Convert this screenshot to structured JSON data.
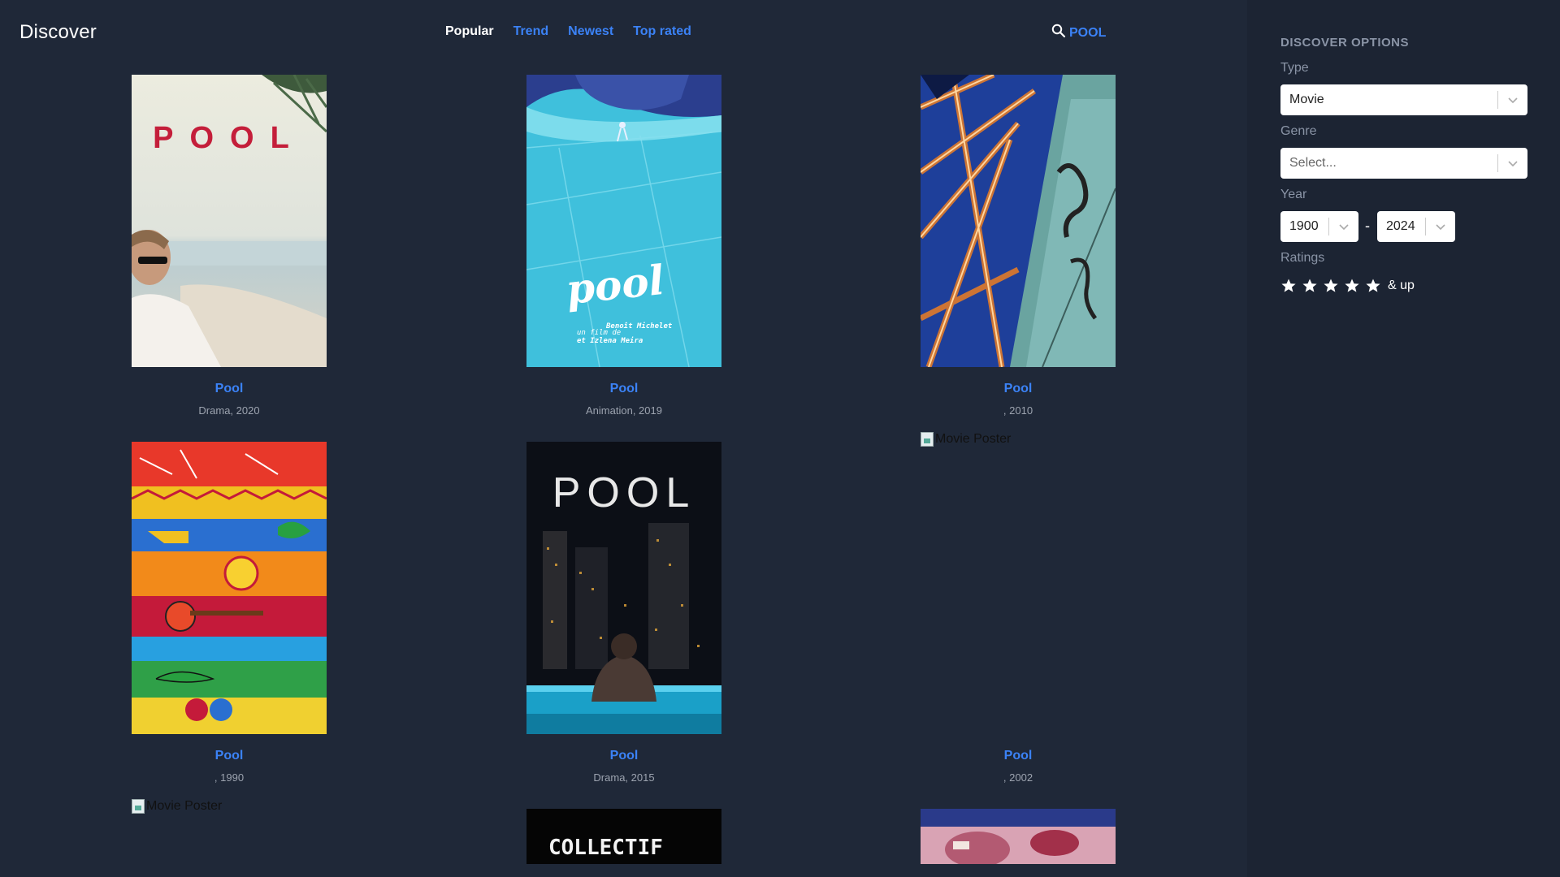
{
  "header": {
    "brand": "Discover",
    "tabs": [
      "Popular",
      "Trend",
      "Newest",
      "Top rated"
    ],
    "active_tab": "Popular",
    "search_icon": "search-icon",
    "search_query": "POOL"
  },
  "movies": [
    {
      "title": "Pool",
      "meta": "Drama, 2020",
      "poster": "beach-man-poster"
    },
    {
      "title": "Pool",
      "meta": "Animation, 2019",
      "poster": "animated-pool-poster"
    },
    {
      "title": "Pool",
      "meta": ", 2010",
      "poster": "graffiti-glass-poster"
    },
    {
      "title": "Pool",
      "meta": ", 1990",
      "poster": "colorful-art-poster"
    },
    {
      "title": "Pool",
      "meta": "Drama, 2015",
      "poster": "night-pool-poster"
    },
    {
      "title": "Pool",
      "meta": ", 2002",
      "poster_alt": "Movie Poster"
    },
    {
      "poster_alt": "Movie Poster"
    },
    {
      "poster": "collectif-poster",
      "poster_text": "COLLECTIF"
    },
    {
      "poster": "red-closeup-poster"
    }
  ],
  "options": {
    "title": "DISCOVER OPTIONS",
    "type_label": "Type",
    "type_value": "Movie",
    "genre_label": "Genre",
    "genre_placeholder": "Select...",
    "year_label": "Year",
    "year_from": "1900",
    "year_to": "2024",
    "year_sep": "-",
    "ratings_label": "Ratings",
    "rating_stars": 5,
    "ratings_suffix": "& up",
    "chevron_icon": "chevron-down-icon",
    "star_icon": "star-icon"
  },
  "colors": {
    "background": "#1f2838",
    "sidebar": "#1c2433",
    "accent": "#3b82f6",
    "muted": "#9ca3af"
  }
}
